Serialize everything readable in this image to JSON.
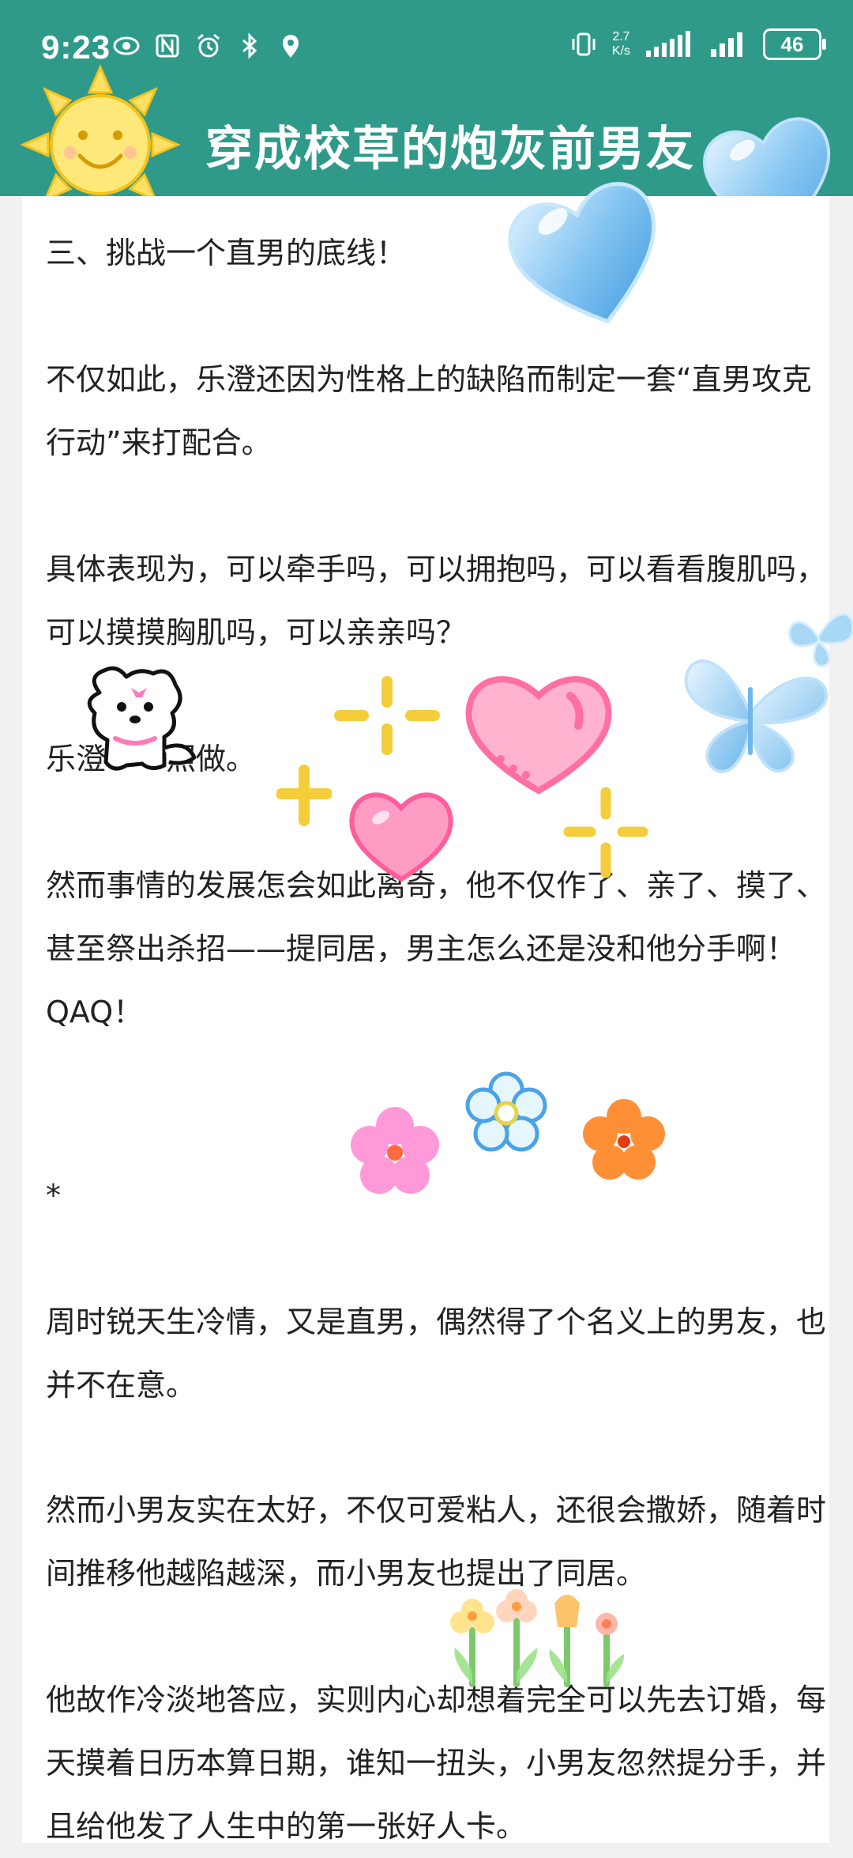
{
  "status_bar": {
    "time": "9:23",
    "net_speed_top": "2.7",
    "net_speed_bottom": "K/s",
    "battery": "46",
    "left_icons": [
      "eye-icon",
      "nfc-icon",
      "alarm-icon",
      "bluetooth-icon",
      "location-icon"
    ],
    "right_icons": [
      "vibrate-icon",
      "signal-icon",
      "signal-icon"
    ]
  },
  "header": {
    "title": "穿成校草的炮灰前男友",
    "background_color": "#2f9a8a",
    "more_icon": "more-dots-icon"
  },
  "article": {
    "paragraphs": [
      "三、挑战一个直男的底线！",
      "不仅如此，乐澄还因为性格上的缺陷而制定一套“直男攻克行动”来打配合。",
      "具体表现为，可以牵手吗，可以拥抱吗，可以看看腹肌吗，可以摸摸胸肌吗，可以亲亲吗？",
      "乐澄一一照做。",
      "然而事情的发展怎会如此离奇，他不仅作了、亲了、摸了、甚至祭出杀招——提同居，男主怎么还是没和他分手啊！QAQ！",
      "*",
      "周时锐天生冷情，又是直男，偶然得了个名义上的男友，也并不在意。",
      "然而小男友实在太好，不仅可爱粘人，还很会撒娇，随着时间推移他越陷越深，而小男友也提出了同居。",
      "他故作冷淡地答应，实则内心却想着完全可以先去订婚，每天摸着日历本算日期，谁知一扭头，小男友忽然提分手，并且给他发了人生中的第一张好人卡。"
    ]
  },
  "decorations": [
    "sun-sticker-icon",
    "heart-sticker-icon",
    "puppy-sticker-icon",
    "butterfly-sticker-icon",
    "flower-sticker-icon",
    "tulip-sticker-icon"
  ]
}
